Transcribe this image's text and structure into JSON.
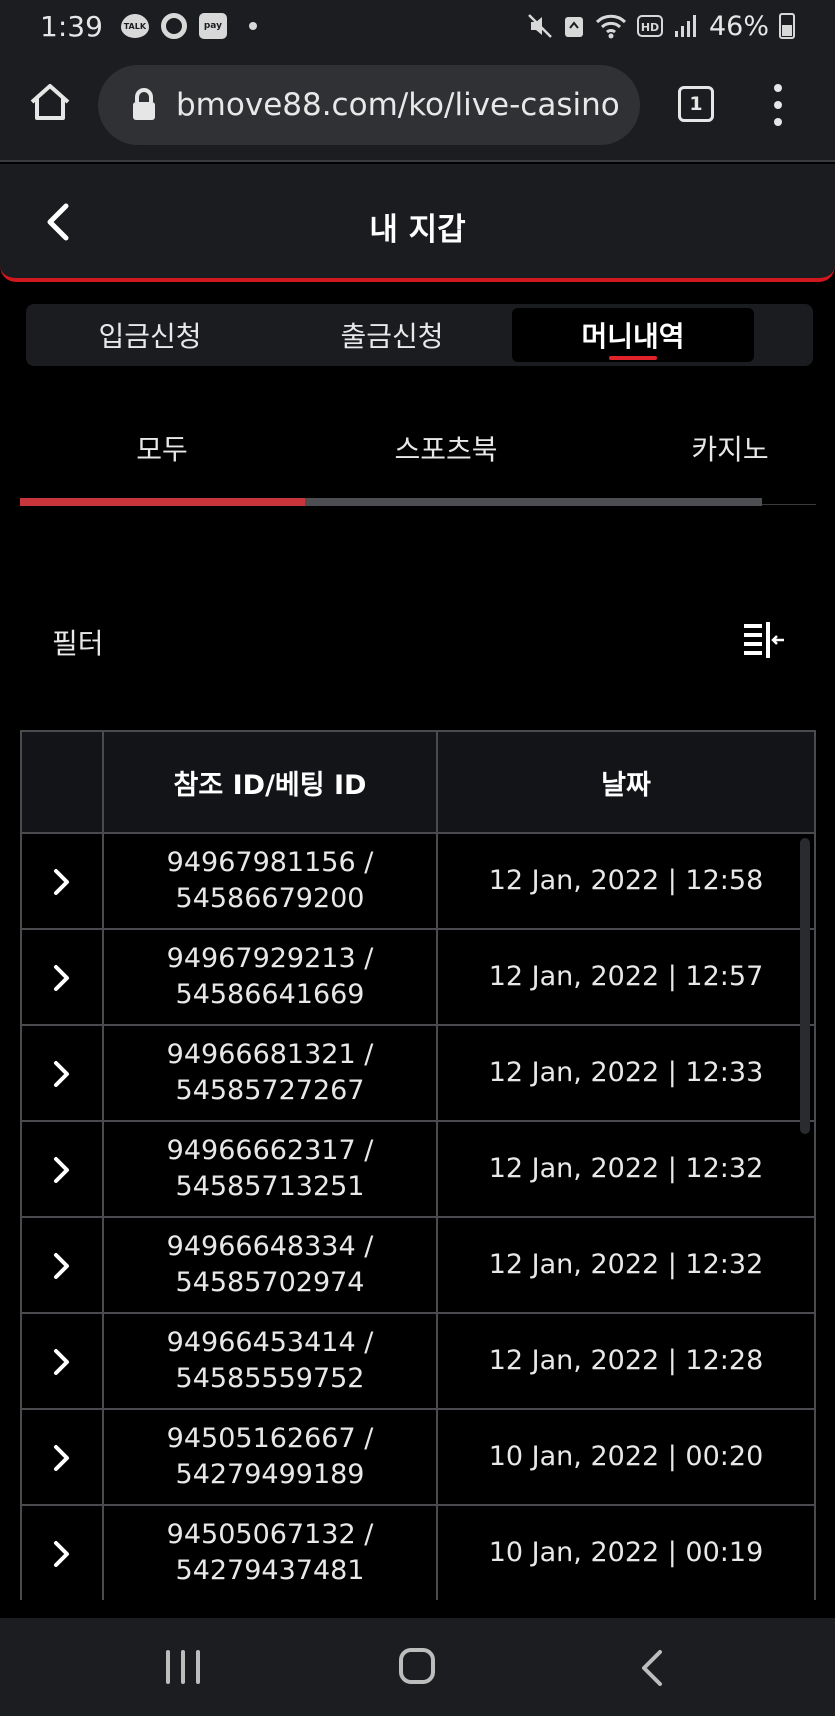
{
  "status_bar": {
    "time": "1:39",
    "battery": "46%",
    "talk_label": "TALK",
    "pay_label": "pay"
  },
  "browser": {
    "url": "bmove88.com/ko/live-casino",
    "tab_count": "1"
  },
  "header": {
    "title": "내 지갑"
  },
  "main_tabs": [
    {
      "label": "입금신청"
    },
    {
      "label": "출금신청"
    },
    {
      "label": "머니내역"
    }
  ],
  "sub_tabs": [
    {
      "label": "모두"
    },
    {
      "label": "스포츠북"
    },
    {
      "label": "카지노"
    }
  ],
  "filter": {
    "label": "필터"
  },
  "table": {
    "headers": [
      "",
      "참조 ID/베팅 ID",
      "날짜"
    ],
    "rows": [
      {
        "ref": "94967981156 /",
        "bet": "54586679200",
        "date": "12 Jan, 2022 | 12:58"
      },
      {
        "ref": "94967929213 /",
        "bet": "54586641669",
        "date": "12 Jan, 2022 | 12:57"
      },
      {
        "ref": "94966681321 /",
        "bet": "54585727267",
        "date": "12 Jan, 2022 | 12:33"
      },
      {
        "ref": "94966662317 /",
        "bet": "54585713251",
        "date": "12 Jan, 2022 | 12:32"
      },
      {
        "ref": "94966648334 /",
        "bet": "54585702974",
        "date": "12 Jan, 2022 | 12:32"
      },
      {
        "ref": "94966453414 /",
        "bet": "54585559752",
        "date": "12 Jan, 2022 | 12:28"
      },
      {
        "ref": "94505162667 /",
        "bet": "54279499189",
        "date": "10 Jan, 2022 | 00:20"
      },
      {
        "ref": "94505067132 /",
        "bet": "54279437481",
        "date": "10 Jan, 2022 | 00:19"
      }
    ]
  },
  "colors": {
    "accent": "#d0171e",
    "panel": "#1b1c20",
    "background": "#000000"
  }
}
